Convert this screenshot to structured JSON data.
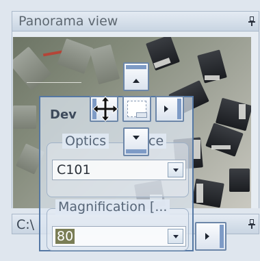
{
  "panorama_panel": {
    "title": "Panorama view",
    "pin_icon": "pin-icon"
  },
  "second_panel": {
    "title": "C:\\"
  },
  "floating_panel": {
    "title": "Dev",
    "optics_group": {
      "legend": "Optics",
      "legend_tail": "ce",
      "value": "C101"
    },
    "magnification_group": {
      "legend": "Magnification [...",
      "value": "80"
    }
  },
  "dock_guides": [
    "dock-top",
    "dock-left",
    "dock-center",
    "dock-right",
    "dock-bottom",
    "dock-outer-right"
  ],
  "colors": {
    "panel_border": "#5477a3",
    "header_bg": "#d4dfeb",
    "guide_accent": "#7e9bc6",
    "value_highlight": "#7a7d55"
  }
}
